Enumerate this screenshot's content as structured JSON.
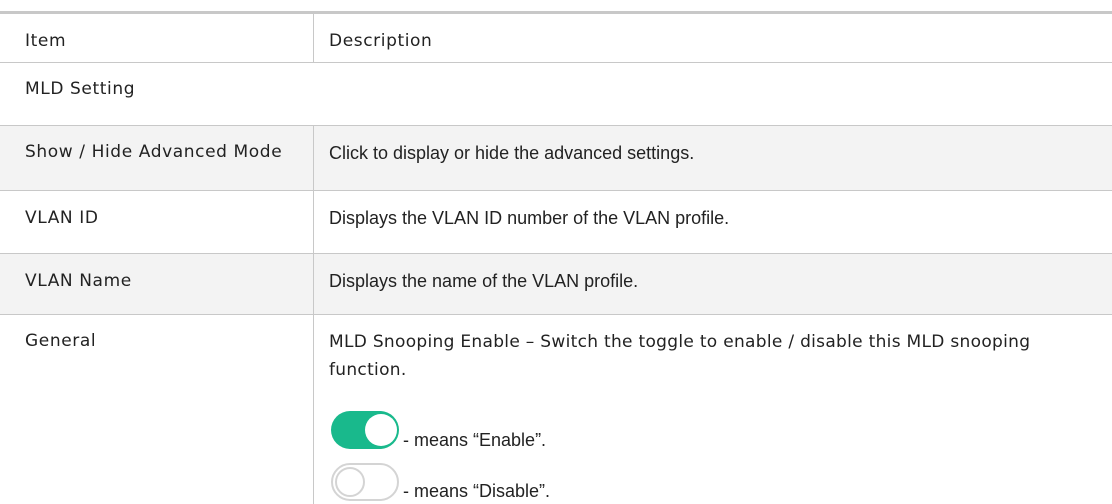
{
  "table": {
    "header": {
      "item": "Item",
      "description": "Description"
    },
    "section_title": "MLD Setting",
    "rows": [
      {
        "item": "Show / Hide Advanced Mode",
        "description": "Click to display or hide the advanced settings."
      },
      {
        "item": "VLAN ID",
        "description": "Displays the VLAN ID number of the VLAN profile."
      },
      {
        "item": "VLAN Name",
        "description": "Displays the name of the VLAN profile."
      },
      {
        "item": "General",
        "description": "MLD Snooping Enable – Switch the toggle to enable / disable this MLD snooping function.",
        "toggle_on_text": "- means “Enable”.",
        "toggle_off_text": "- means “Disable”."
      }
    ]
  },
  "colors": {
    "toggle_on": "#19b98c",
    "toggle_off_border": "#d4d4d4",
    "grid": "#c8c8c8"
  }
}
